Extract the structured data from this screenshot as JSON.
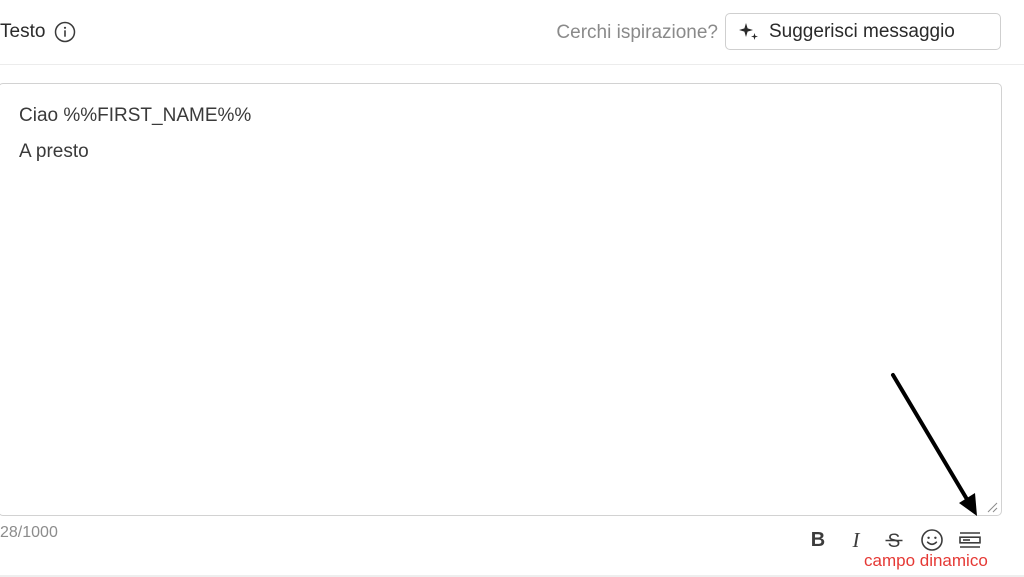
{
  "header": {
    "title": "Testo",
    "info_icon": "info-icon",
    "inspiration_text": "Cerchi ispirazione?",
    "suggest_button": {
      "label": "Suggerisci messaggio",
      "icon": "sparkle-icon"
    }
  },
  "editor": {
    "lines": [
      "Ciao %%FIRST_NAME%%",
      "A presto"
    ],
    "char_count": "28/1000"
  },
  "toolbar": {
    "tools": [
      {
        "name": "bold",
        "glyph": "B"
      },
      {
        "name": "italic",
        "glyph": "I"
      },
      {
        "name": "strikethrough",
        "glyph": "S"
      },
      {
        "name": "emoji",
        "icon": "smiley-icon"
      },
      {
        "name": "dynamic-field",
        "icon": "dynamic-field-icon"
      }
    ]
  },
  "annotation": {
    "label": "campo dinamico",
    "color": "#e53935"
  },
  "colors": {
    "border": "#d2d2d2",
    "muted_text": "#8a8a8a",
    "annotation": "#e53935"
  }
}
